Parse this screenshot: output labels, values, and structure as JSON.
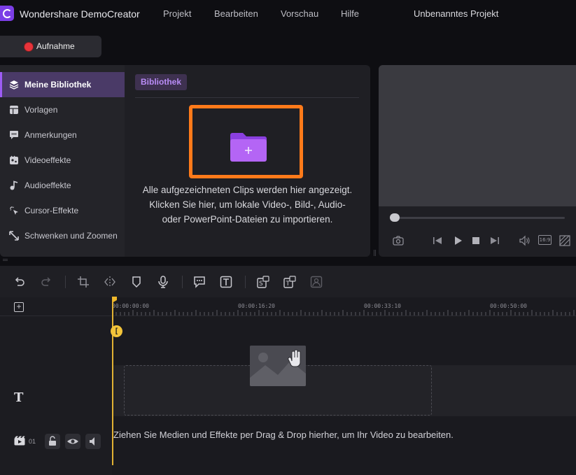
{
  "app": {
    "title": "Wondershare DemoCreator",
    "project": "Unbenanntes Projekt"
  },
  "menu": [
    "Projekt",
    "Bearbeiten",
    "Vorschau",
    "Hilfe"
  ],
  "record": {
    "label": "Aufnahme"
  },
  "sidebar": {
    "items": [
      {
        "label": "Meine Bibliothek",
        "icon": "layers-icon",
        "active": true
      },
      {
        "label": "Vorlagen",
        "icon": "template-icon"
      },
      {
        "label": "Anmerkungen",
        "icon": "speech-bubble-icon"
      },
      {
        "label": "Videoeffekte",
        "icon": "video-effects-icon"
      },
      {
        "label": "Audioeffekte",
        "icon": "music-note-icon"
      },
      {
        "label": "Cursor-Effekte",
        "icon": "cursor-effects-icon"
      },
      {
        "label": "Schwenken und Zoomen",
        "icon": "pan-zoom-icon"
      }
    ]
  },
  "library": {
    "tab": "Bibliothek",
    "hint_lines": [
      "Alle aufgezeichneten Clips werden hier angezeigt.",
      "Klicken Sie hier, um lokale Video-, Bild-, Audio-",
      "oder PowerPoint-Dateien zu importieren."
    ]
  },
  "preview": {
    "aspect_label": "16:9",
    "progress": 0.0
  },
  "timeline": {
    "ticks": [
      "00:00:00:00",
      "00:00:16:20",
      "00:00:33:10",
      "00:00:50:00"
    ],
    "track_number": "01",
    "drop_hint": "Ziehen Sie Medien und Effekte per Drag & Drop hierher, um Ihr Video zu bearbeiten."
  },
  "colors": {
    "accent": "#9d5cf5",
    "highlight": "#ff7a1a",
    "playhead": "#f0b82b",
    "record": "#e8333a"
  }
}
